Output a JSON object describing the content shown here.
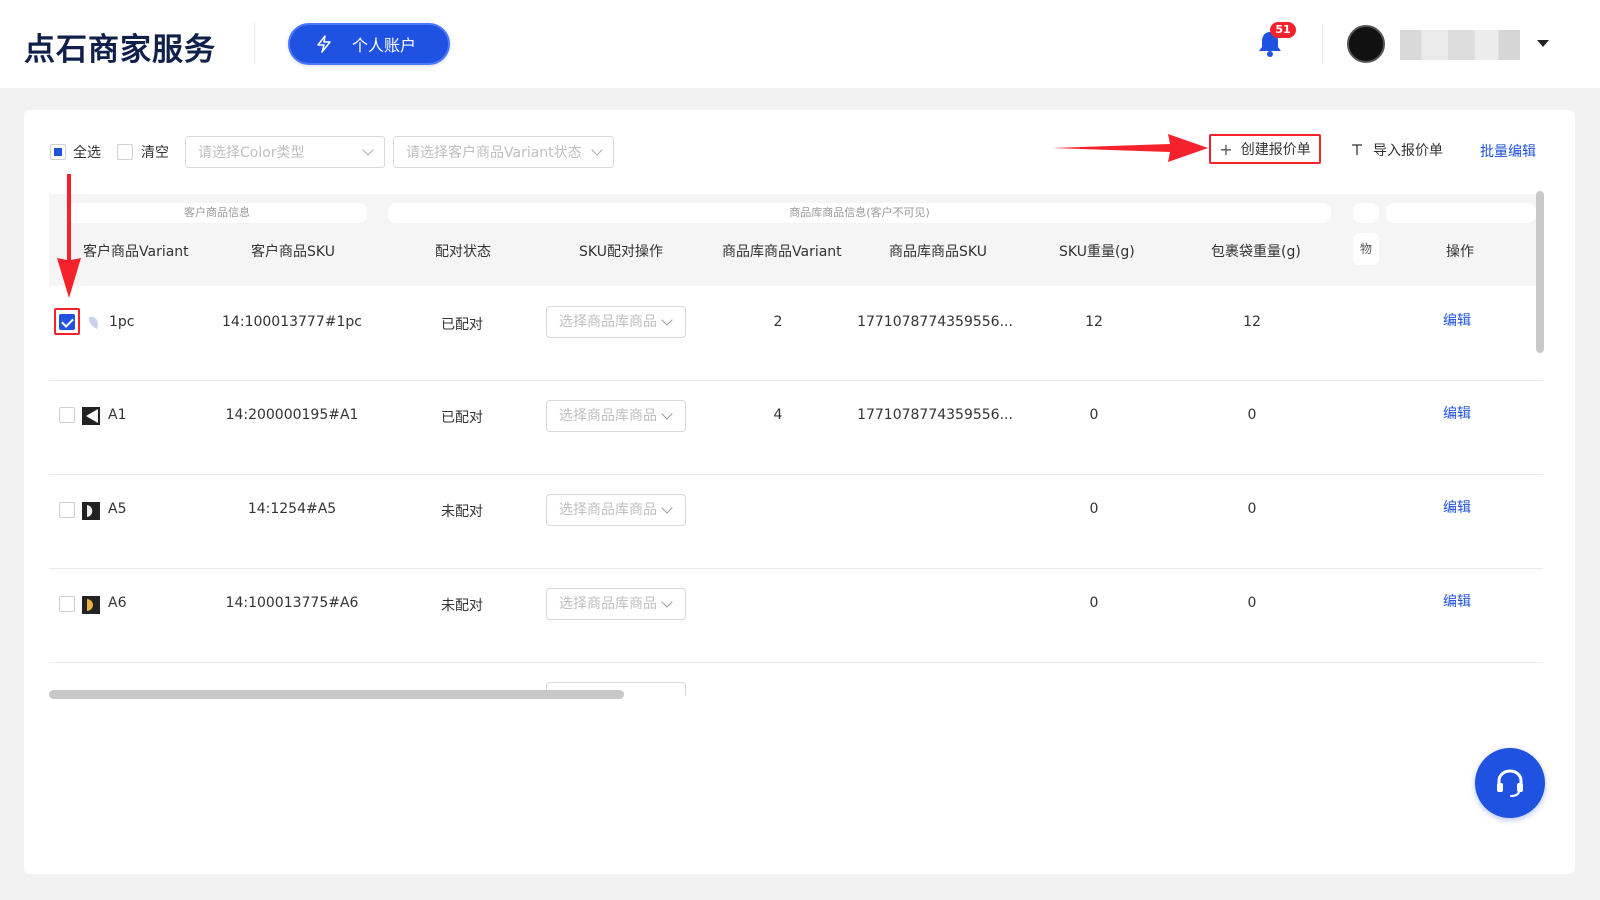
{
  "header": {
    "logo": "点石商家服务",
    "account_button": "个人账户",
    "notification_count": "51",
    "username": ""
  },
  "toolbar": {
    "select_all": "全选",
    "clear": "清空",
    "color_type_placeholder": "请选择Color类型",
    "variant_status_placeholder": "请选择客户商品Variant状态",
    "create_quote": "创建报价单",
    "import_quote": "导入报价单",
    "batch_edit": "批量编辑"
  },
  "table": {
    "groups": {
      "customer_info": "客户商品信息",
      "library_info": "商品库商品信息(客户不可见)"
    },
    "columns": {
      "variant": "客户商品Variant",
      "sku": "客户商品SKU",
      "match_status": "配对状态",
      "sku_match_action": "SKU配对操作",
      "lib_variant": "商品库商品Variant",
      "lib_sku": "商品库商品SKU",
      "sku_weight": "SKU重量(g)",
      "bag_weight": "包裹袋重量(g)",
      "truncated": "物",
      "actions": "操作"
    },
    "select_placeholder": "选择商品库商品",
    "edit_label": "编辑",
    "rows": [
      {
        "checked": true,
        "variant": "1pc",
        "sku": "14:100013777#1pc",
        "status": "已配对",
        "lib_variant": "2",
        "lib_sku": "1771078774359556...",
        "sku_weight": "12",
        "bag_weight": "12"
      },
      {
        "checked": false,
        "variant": "A1",
        "sku": "14:200000195#A1",
        "status": "已配对",
        "lib_variant": "4",
        "lib_sku": "1771078774359556...",
        "sku_weight": "0",
        "bag_weight": "0"
      },
      {
        "checked": false,
        "variant": "A5",
        "sku": "14:1254#A5",
        "status": "未配对",
        "lib_variant": "",
        "lib_sku": "",
        "sku_weight": "0",
        "bag_weight": "0"
      },
      {
        "checked": false,
        "variant": "A6",
        "sku": "14:100013775#A6",
        "status": "未配对",
        "lib_variant": "",
        "lib_sku": "",
        "sku_weight": "0",
        "bag_weight": "0"
      }
    ]
  },
  "colors": {
    "primary": "#1f52e0",
    "annotation_red": "#f5222d"
  },
  "icons": {
    "bolt": "lightning-icon",
    "bell": "bell-icon",
    "plus": "plus-icon",
    "import": "import-icon",
    "support": "headset-icon"
  }
}
